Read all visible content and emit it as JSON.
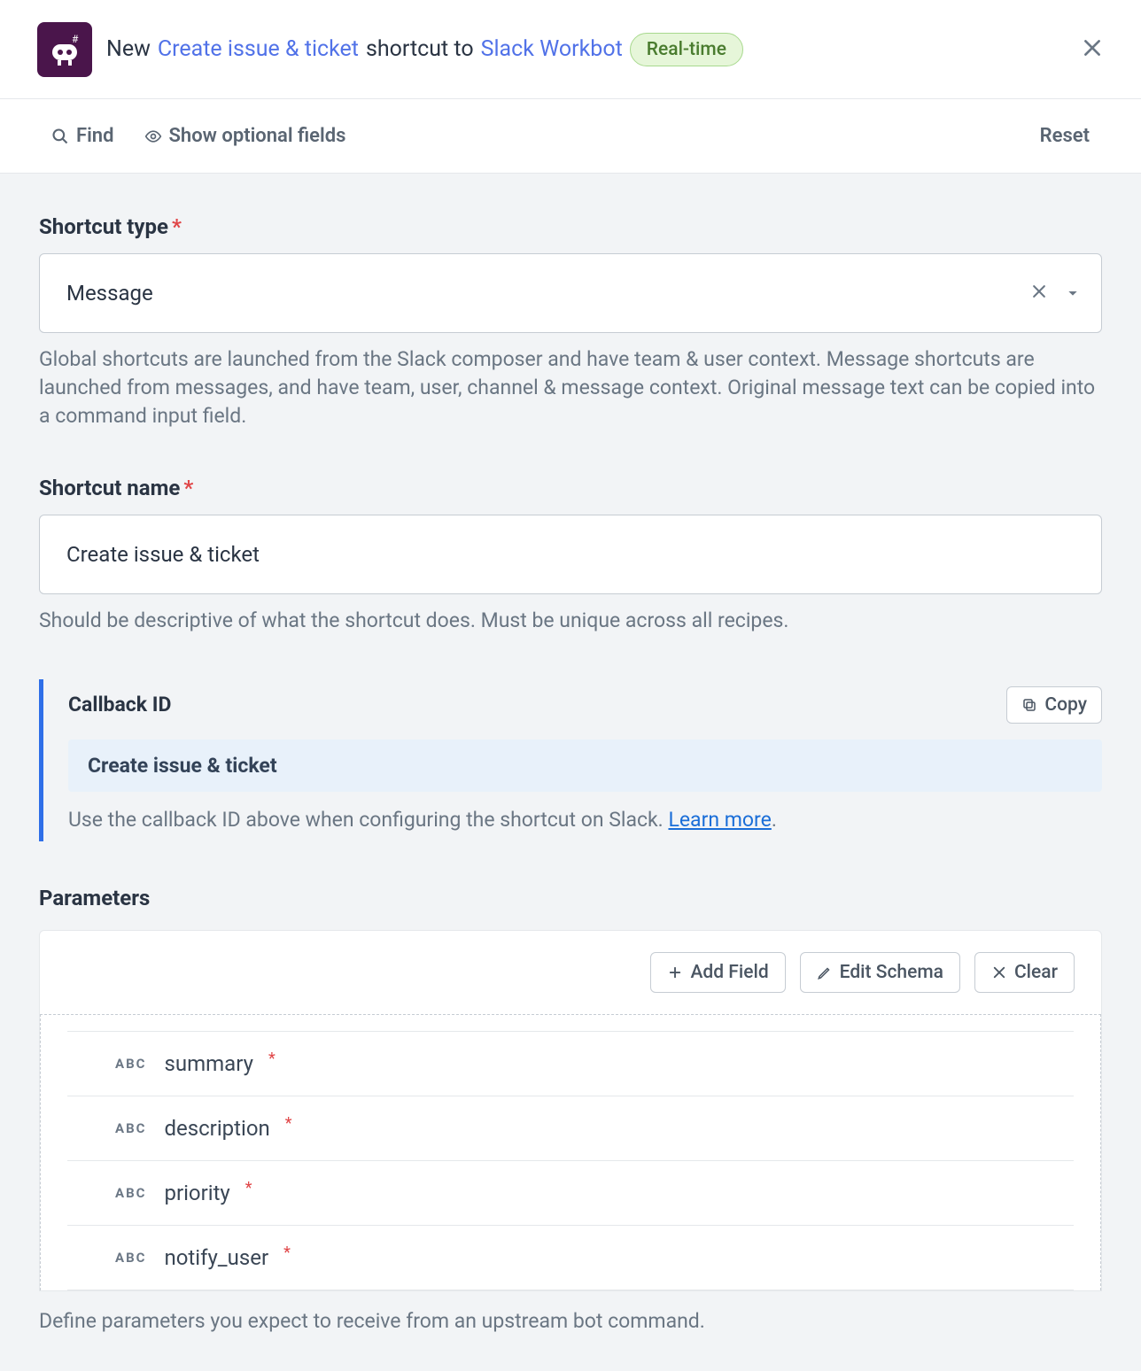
{
  "header": {
    "title_prefix": "New",
    "shortcut_link": "Create issue & ticket",
    "title_mid": "shortcut to",
    "target_link": "Slack Workbot",
    "badge": "Real-time"
  },
  "toolbar": {
    "find": "Find",
    "show_optional": "Show optional fields",
    "reset": "Reset"
  },
  "shortcut_type": {
    "label": "Shortcut type",
    "value": "Message",
    "help": "Global shortcuts are launched from the Slack composer and have team & user context. Message shortcuts are launched from messages, and have team, user, channel & message context. Original message text can be copied into a command input field."
  },
  "shortcut_name": {
    "label": "Shortcut name",
    "value": "Create issue & ticket",
    "help": "Should be descriptive of what the shortcut does. Must be unique across all recipes."
  },
  "callback": {
    "title": "Callback ID",
    "copy": "Copy",
    "value": "Create issue & ticket",
    "help_prefix": "Use the callback ID above when configuring the shortcut on Slack. ",
    "learn_more": "Learn more",
    "period": "."
  },
  "parameters": {
    "label": "Parameters",
    "add_field": "Add Field",
    "edit_schema": "Edit Schema",
    "clear": "Clear",
    "type_badge": "ABC",
    "items": [
      {
        "name": "summary"
      },
      {
        "name": "description"
      },
      {
        "name": "priority"
      },
      {
        "name": "notify_user"
      }
    ],
    "help": "Define parameters you expect to receive from an upstream bot command."
  }
}
